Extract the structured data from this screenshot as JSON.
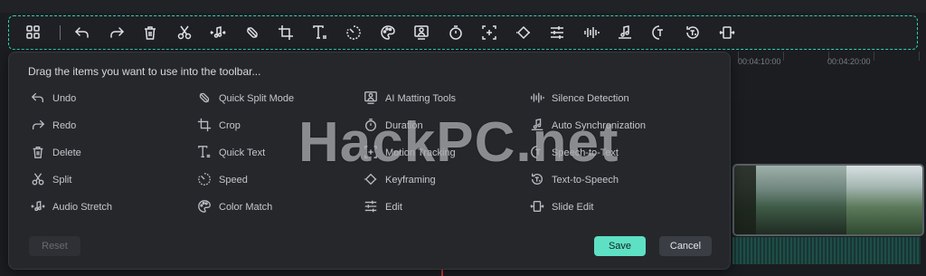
{
  "toolbar_icons": [
    "layout-grid-icon",
    "undo-icon",
    "redo-icon",
    "delete-icon",
    "split-icon",
    "audio-stretch-icon",
    "quick-split-mode-icon",
    "crop-icon",
    "quick-text-icon",
    "speed-icon",
    "color-match-icon",
    "ai-matting-icon",
    "duration-icon",
    "motion-tracking-icon",
    "keyframing-icon",
    "edit-icon",
    "silence-detection-icon",
    "auto-synchronization-icon",
    "speech-to-text-icon",
    "text-to-speech-icon",
    "slide-edit-icon"
  ],
  "panel": {
    "title": "Drag the items you want to use into the toolbar...",
    "columns": [
      [
        {
          "label": "Undo",
          "icon": "undo-icon"
        },
        {
          "label": "Redo",
          "icon": "redo-icon"
        },
        {
          "label": "Delete",
          "icon": "delete-icon"
        },
        {
          "label": "Split",
          "icon": "split-icon"
        },
        {
          "label": "Audio Stretch",
          "icon": "audio-stretch-icon"
        }
      ],
      [
        {
          "label": "Quick Split Mode",
          "icon": "quick-split-mode-icon"
        },
        {
          "label": "Crop",
          "icon": "crop-icon"
        },
        {
          "label": "Quick Text",
          "icon": "quick-text-icon"
        },
        {
          "label": "Speed",
          "icon": "speed-icon"
        },
        {
          "label": "Color Match",
          "icon": "color-match-icon"
        }
      ],
      [
        {
          "label": "AI Matting Tools",
          "icon": "ai-matting-icon"
        },
        {
          "label": "Duration",
          "icon": "duration-icon"
        },
        {
          "label": "Motion Tracking",
          "icon": "motion-tracking-icon"
        },
        {
          "label": "Keyframing",
          "icon": "keyframing-icon"
        },
        {
          "label": "Edit",
          "icon": "edit-icon"
        }
      ],
      [
        {
          "label": "Silence Detection",
          "icon": "silence-detection-icon"
        },
        {
          "label": "Auto Synchronization",
          "icon": "auto-synchronization-icon"
        },
        {
          "label": "Speech-to-Text",
          "icon": "speech-to-text-icon"
        },
        {
          "label": "Text-to-Speech",
          "icon": "text-to-speech-icon"
        },
        {
          "label": "Slide Edit",
          "icon": "slide-edit-icon"
        }
      ]
    ],
    "reset_label": "Reset",
    "save_label": "Save",
    "cancel_label": "Cancel"
  },
  "timeline": {
    "ruler_labels": [
      "00:04:10:00",
      "00:04:20:00"
    ]
  },
  "watermark": "HackPC.net",
  "colors": {
    "accent": "#5ee0c4",
    "toolbar_border": "#2fd3b4",
    "panel_bg": "#25272b"
  }
}
